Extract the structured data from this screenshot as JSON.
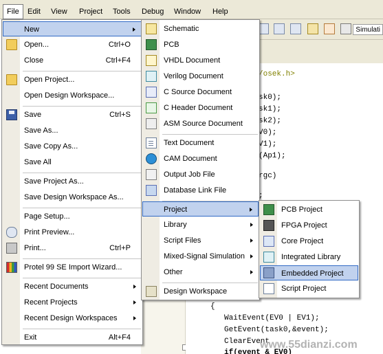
{
  "menubar": [
    "File",
    "Edit",
    "View",
    "Project",
    "Tools",
    "Debug",
    "Window",
    "Help"
  ],
  "toolbar": {
    "sim_label": "Simulati"
  },
  "code_lines": [
    {
      "text": "/osek.h>",
      "kind": "pp"
    },
    {
      "text": "sk0);",
      "kind": "normal"
    },
    {
      "text": "sk1);",
      "kind": "normal"
    },
    {
      "text": "sk2);",
      "kind": "normal"
    },
    {
      "text": "V0);",
      "kind": "normal"
    },
    {
      "text": "V1);",
      "kind": "normal"
    },
    {
      "text": "(Ap1);",
      "kind": "normal"
    },
    {
      "text": "rgc)",
      "kind": "normal"
    },
    {
      "text": ";",
      "kind": "normal"
    },
    {
      "text": "{",
      "kind": "normal"
    },
    {
      "text": "WaitEvent(EV0 | EV1);",
      "kind": "normal"
    },
    {
      "text": "GetEvent(task0,&event);",
      "kind": "normal"
    },
    {
      "text": "ClearEvent",
      "kind": "normal"
    },
    {
      "text": "if(event & EV0)",
      "kind": "bold"
    }
  ],
  "watermark": "www.55dianzi.com",
  "file_menu": {
    "items": [
      {
        "label": "New",
        "underline": "N",
        "shortcut": "",
        "submenu": true,
        "icon": "",
        "highlighted": true
      },
      {
        "label": "Open...",
        "underline": "O",
        "shortcut": "Ctrl+O",
        "icon": "open-folder-icon"
      },
      {
        "label": "Close",
        "underline": "C",
        "shortcut": "Ctrl+F4",
        "icon": ""
      },
      {
        "label": "Open Project...",
        "underline": "",
        "shortcut": "",
        "icon": "open-project-icon"
      },
      {
        "label": "Open Design Workspace...",
        "underline": "",
        "shortcut": "",
        "icon": ""
      },
      {
        "label": "Save",
        "underline": "S",
        "shortcut": "Ctrl+S",
        "icon": "save-icon"
      },
      {
        "label": "Save As...",
        "underline": "A",
        "shortcut": "",
        "icon": ""
      },
      {
        "label": "Save Copy As...",
        "underline": "",
        "shortcut": "",
        "icon": ""
      },
      {
        "label": "Save All",
        "underline": "",
        "shortcut": "",
        "icon": ""
      },
      {
        "label": "Save Project As...",
        "underline": "",
        "shortcut": "",
        "icon": ""
      },
      {
        "label": "Save Design Workspace As...",
        "underline": "",
        "shortcut": "",
        "icon": ""
      },
      {
        "label": "Page Setup...",
        "underline": "",
        "shortcut": "",
        "icon": ""
      },
      {
        "label": "Print Preview...",
        "underline": "",
        "shortcut": "",
        "icon": "print-preview-icon"
      },
      {
        "label": "Print...",
        "underline": "P",
        "shortcut": "Ctrl+P",
        "icon": "print-icon"
      },
      {
        "label": "Protel 99 SE Import Wizard...",
        "underline": "",
        "shortcut": "",
        "icon": "protel-icon"
      },
      {
        "label": "Recent Documents",
        "underline": "",
        "shortcut": "",
        "submenu": true,
        "icon": ""
      },
      {
        "label": "Recent Projects",
        "underline": "",
        "shortcut": "",
        "submenu": true,
        "icon": ""
      },
      {
        "label": "Recent Design Workspaces",
        "underline": "",
        "shortcut": "",
        "submenu": true,
        "icon": ""
      },
      {
        "label": "Exit",
        "underline": "x",
        "shortcut": "Alt+F4",
        "icon": ""
      }
    ]
  },
  "new_menu": {
    "items": [
      {
        "label": "Schematic",
        "icon": "schematic-icon"
      },
      {
        "label": "PCB",
        "icon": "pcb-icon"
      },
      {
        "label": "VHDL Document",
        "icon": "vhdl-icon"
      },
      {
        "label": "Verilog Document",
        "icon": "verilog-icon"
      },
      {
        "label": "C Source Document",
        "icon": "c-source-icon"
      },
      {
        "label": "C Header Document",
        "icon": "c-header-icon"
      },
      {
        "label": "ASM Source Document",
        "icon": "asm-icon"
      },
      {
        "label": "Text Document",
        "icon": "text-document-icon"
      },
      {
        "label": "CAM Document",
        "icon": "cam-icon"
      },
      {
        "label": "Output Job File",
        "icon": "output-job-icon"
      },
      {
        "label": "Database Link File",
        "icon": "database-link-icon"
      },
      {
        "label": "Project",
        "submenu": true,
        "highlighted": true,
        "icon": ""
      },
      {
        "label": "Library",
        "submenu": true,
        "icon": ""
      },
      {
        "label": "Script Files",
        "submenu": true,
        "icon": ""
      },
      {
        "label": "Mixed-Signal Simulation",
        "submenu": true,
        "icon": ""
      },
      {
        "label": "Other",
        "submenu": true,
        "icon": ""
      },
      {
        "label": "Design Workspace",
        "icon": "design-workspace-icon"
      }
    ]
  },
  "project_menu": {
    "items": [
      {
        "label": "PCB Project",
        "icon": "pcb-project-icon"
      },
      {
        "label": "FPGA Project",
        "icon": "fpga-project-icon"
      },
      {
        "label": "Core Project",
        "icon": "core-project-icon"
      },
      {
        "label": "Integrated Library",
        "icon": "integrated-library-icon"
      },
      {
        "label": "Embedded Project",
        "icon": "embedded-project-icon",
        "highlighted": true
      },
      {
        "label": "Script Project",
        "icon": "script-project-icon"
      }
    ]
  }
}
